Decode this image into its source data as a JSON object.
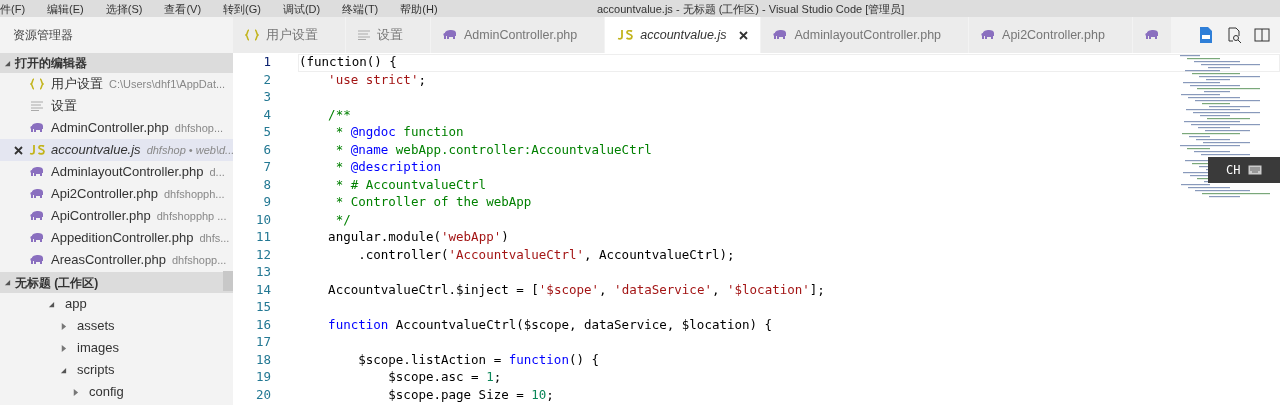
{
  "menu": [
    "件(F)",
    "编辑(E)",
    "选择(S)",
    "查看(V)",
    "转到(G)",
    "调试(D)",
    "终端(T)",
    "帮助(H)"
  ],
  "window": {
    "title": "accountvalue.js - 无标题 (工作区) - Visual Studio Code [管理员]"
  },
  "sidebar": {
    "title": "资源管理器",
    "open_editors": {
      "label": "打开的编辑器",
      "expanded": true,
      "items": [
        {
          "kind": "json",
          "name": "用户设置",
          "path": "C:\\Users\\dhf1\\AppDat...",
          "selected": false
        },
        {
          "kind": "settings",
          "name": "设置",
          "selected": false
        },
        {
          "kind": "php",
          "name": "AdminController.php",
          "path": "dhfshop...",
          "selected": false,
          "italic": false
        },
        {
          "kind": "js",
          "name": "accountvalue.js",
          "path": "dhfshop • web\\d...",
          "selected": true,
          "italic": true
        },
        {
          "kind": "php",
          "name": "AdminlayoutController.php",
          "path": "d...",
          "selected": false,
          "italic": false
        },
        {
          "kind": "php",
          "name": "Api2Controller.php",
          "path": "dhfshopph...",
          "selected": false,
          "italic": false
        },
        {
          "kind": "php",
          "name": "ApiController.php",
          "path": "dhfshopphp ...",
          "selected": false,
          "italic": false
        },
        {
          "kind": "php",
          "name": "AppeditionController.php",
          "path": "dhfs...",
          "selected": false,
          "italic": false
        },
        {
          "kind": "php",
          "name": "AreasController.php",
          "path": "dhfshopp...",
          "selected": false,
          "italic": false
        }
      ]
    },
    "workspace": {
      "label": "无标题 (工作区)",
      "expanded": true,
      "tree": [
        {
          "name": "app",
          "expanded": true,
          "children": [
            {
              "name": "assets",
              "expanded": false
            },
            {
              "name": "images",
              "expanded": false
            },
            {
              "name": "scripts",
              "expanded": true,
              "children": [
                {
                  "name": "config",
                  "expanded": false
                }
              ]
            }
          ]
        }
      ]
    }
  },
  "tabs": [
    {
      "kind": "json",
      "label": "用户设置",
      "selected": false
    },
    {
      "kind": "settings",
      "label": "设置",
      "selected": false
    },
    {
      "kind": "php",
      "label": "AdminController.php",
      "selected": false,
      "italic": false
    },
    {
      "kind": "js",
      "label": "accountvalue.js",
      "selected": true,
      "italic": true
    },
    {
      "kind": "php",
      "label": "AdminlayoutController.php",
      "selected": false,
      "italic": false
    },
    {
      "kind": "php",
      "label": "Api2Controller.php",
      "selected": false,
      "italic": false
    },
    {
      "kind": "php",
      "selected": false
    }
  ],
  "editor": {
    "lines": [
      {
        "n": "1",
        "tokens": [
          {
            "kind": "plain",
            "text": "(function() {"
          }
        ]
      },
      {
        "n": "2",
        "tokens": [
          {
            "kind": "string",
            "text": "    'use strict'"
          },
          {
            "kind": "plain",
            "text": ";"
          }
        ]
      },
      {
        "n": "3"
      },
      {
        "n": "4",
        "tokens": [
          {
            "kind": "comment",
            "text": "    /**"
          }
        ]
      },
      {
        "n": "5",
        "tokens": [
          {
            "kind": "comment",
            "text": "     *"
          },
          {
            "kind": "doctag",
            "text": " @ngdoc"
          },
          {
            "kind": "comment",
            "text": " function"
          }
        ]
      },
      {
        "n": "6",
        "tokens": [
          {
            "kind": "comment",
            "text": "     *"
          },
          {
            "kind": "doctag",
            "text": " @name"
          },
          {
            "kind": "comment",
            "text": " webApp.controller:AccountvalueCtrl"
          }
        ]
      },
      {
        "n": "7",
        "tokens": [
          {
            "kind": "comment",
            "text": "     *"
          },
          {
            "kind": "doctag",
            "text": " @description"
          }
        ]
      },
      {
        "n": "8",
        "tokens": [
          {
            "kind": "comment",
            "text": "     * # AccountvalueCtrl"
          }
        ]
      },
      {
        "n": "9",
        "tokens": [
          {
            "kind": "comment",
            "text": "     * Controller of the webApp"
          }
        ]
      },
      {
        "n": "10",
        "tokens": [
          {
            "kind": "comment",
            "text": "     */"
          }
        ]
      },
      {
        "n": "11",
        "tokens": [
          {
            "kind": "plain",
            "text": "    angular.module("
          },
          {
            "kind": "string",
            "text": "'webApp'"
          },
          {
            "kind": "plain",
            "text": ")"
          }
        ]
      },
      {
        "n": "12",
        "tokens": [
          {
            "kind": "plain",
            "text": "        .controller("
          },
          {
            "kind": "string",
            "text": "'AccountvalueCtrl'"
          },
          {
            "kind": "plain",
            "text": ", AccountvalueCtrl);"
          }
        ]
      },
      {
        "n": "13"
      },
      {
        "n": "14",
        "tokens": [
          {
            "kind": "plain",
            "text": "    AccountvalueCtrl.$inject = ["
          },
          {
            "kind": "string",
            "text": "'$scope'"
          },
          {
            "kind": "plain",
            "text": ", "
          },
          {
            "kind": "string",
            "text": "'dataService'"
          },
          {
            "kind": "plain",
            "text": ", "
          },
          {
            "kind": "string",
            "text": "'$location'"
          },
          {
            "kind": "plain",
            "text": "];"
          }
        ]
      },
      {
        "n": "15"
      },
      {
        "n": "16",
        "tokens": [
          {
            "kind": "keyword",
            "text": "    function"
          },
          {
            "kind": "plain",
            "text": " AccountvalueCtrl($scope, dataService, $location) {"
          }
        ]
      },
      {
        "n": "17"
      },
      {
        "n": "18",
        "tokens": [
          {
            "kind": "plain",
            "text": "        $scope.listAction = "
          },
          {
            "kind": "keyword",
            "text": "function"
          },
          {
            "kind": "plain",
            "text": "() {"
          }
        ]
      },
      {
        "n": "19",
        "tokens": [
          {
            "kind": "plain",
            "text": "            $scope.asc = "
          },
          {
            "kind": "number",
            "text": "1"
          },
          {
            "kind": "plain",
            "text": ";"
          }
        ]
      },
      {
        "n": "20",
        "tokens": [
          {
            "kind": "plain",
            "text": "            $scope.page Size = "
          },
          {
            "kind": "number",
            "text": "10"
          },
          {
            "kind": "plain",
            "text": ";"
          }
        ]
      }
    ]
  },
  "ime": {
    "label": "CH"
  }
}
